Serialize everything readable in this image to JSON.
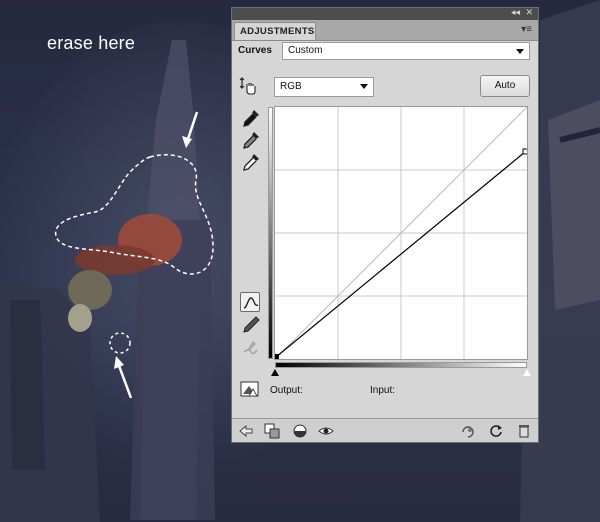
{
  "annotation": {
    "text": "erase here"
  },
  "panel": {
    "tab_label": "ADJUSTMENTS",
    "topstrip": {
      "collapse": "◂◂",
      "close": "✕"
    },
    "tab_menu": "▾≡",
    "curves_label": "Curves",
    "preset_value": "Custom",
    "channel_value": "RGB",
    "auto_label": "Auto",
    "output_label": "Output:",
    "input_label": "Input:"
  },
  "colors": {
    "panel_bg": "#d6d6d6",
    "curve": "#000000",
    "grid": "#c8c8c8",
    "background": "#2a3048"
  },
  "icons": {
    "tools": [
      "on-image-adjust-icon",
      "black-point-eyedropper-icon",
      "gray-point-eyedropper-icon",
      "white-point-eyedropper-icon",
      "curve-edit-icon",
      "pencil-icon",
      "smooth-icon",
      "clipping-warning-icon"
    ],
    "bottom": [
      "back-arrow-icon",
      "clip-to-layer-icon",
      "mask-icon",
      "visibility-eye-icon",
      "previous-state-icon",
      "reset-icon",
      "delete-icon"
    ]
  }
}
